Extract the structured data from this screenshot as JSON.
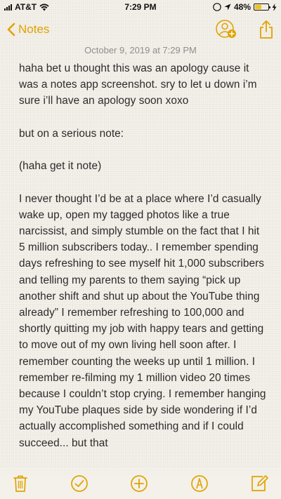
{
  "status_bar": {
    "carrier": "AT&T",
    "time": "7:29 PM",
    "battery_percent": "48%",
    "battery_level": 0.48,
    "icons": [
      "signal-bars-icon",
      "wifi-icon",
      "do-not-disturb-icon",
      "location-arrow-icon",
      "battery-icon",
      "charging-bolt-icon"
    ]
  },
  "nav": {
    "back_label": "Notes",
    "icons": [
      "chevron-left-icon",
      "add-people-icon",
      "share-icon"
    ]
  },
  "note": {
    "date": "October 9, 2019 at 7:29 PM",
    "paragraphs": [
      "haha bet u thought this was an apology cause it was a notes app screenshot. sry to let u down i’m sure i’ll have an apology soon xoxo",
      "but on a serious note:",
      "(haha get it note)",
      "I never thought I’d be at a place where I’d casually wake up, open my tagged photos like a true narcissist, and simply stumble on the fact that I hit 5 million subscribers today.. I remember spending days refreshing to see myself hit 1,000 subscribers and telling my parents to them saying “pick up another shift and shut up about the YouTube thing already” I remember refreshing to 100,000 and shortly quitting my job with happy tears and getting to move out of my own living hell soon after. I remember counting the weeks up until 1 million. I remember re-filming my 1 million video 20 times because I couldn’t stop crying. I remember hanging my YouTube plaques side by side wondering if I’d actually accomplished something and if I could succeed... but that"
    ]
  },
  "toolbar": {
    "icons": [
      "trash-icon",
      "checklist-icon",
      "add-icon",
      "markup-pen-icon",
      "compose-icon"
    ]
  },
  "colors": {
    "accent": "#e0a300",
    "paper": "#f4f1ea",
    "text": "#2b2b2b",
    "date_text": "#8e8e8e"
  }
}
